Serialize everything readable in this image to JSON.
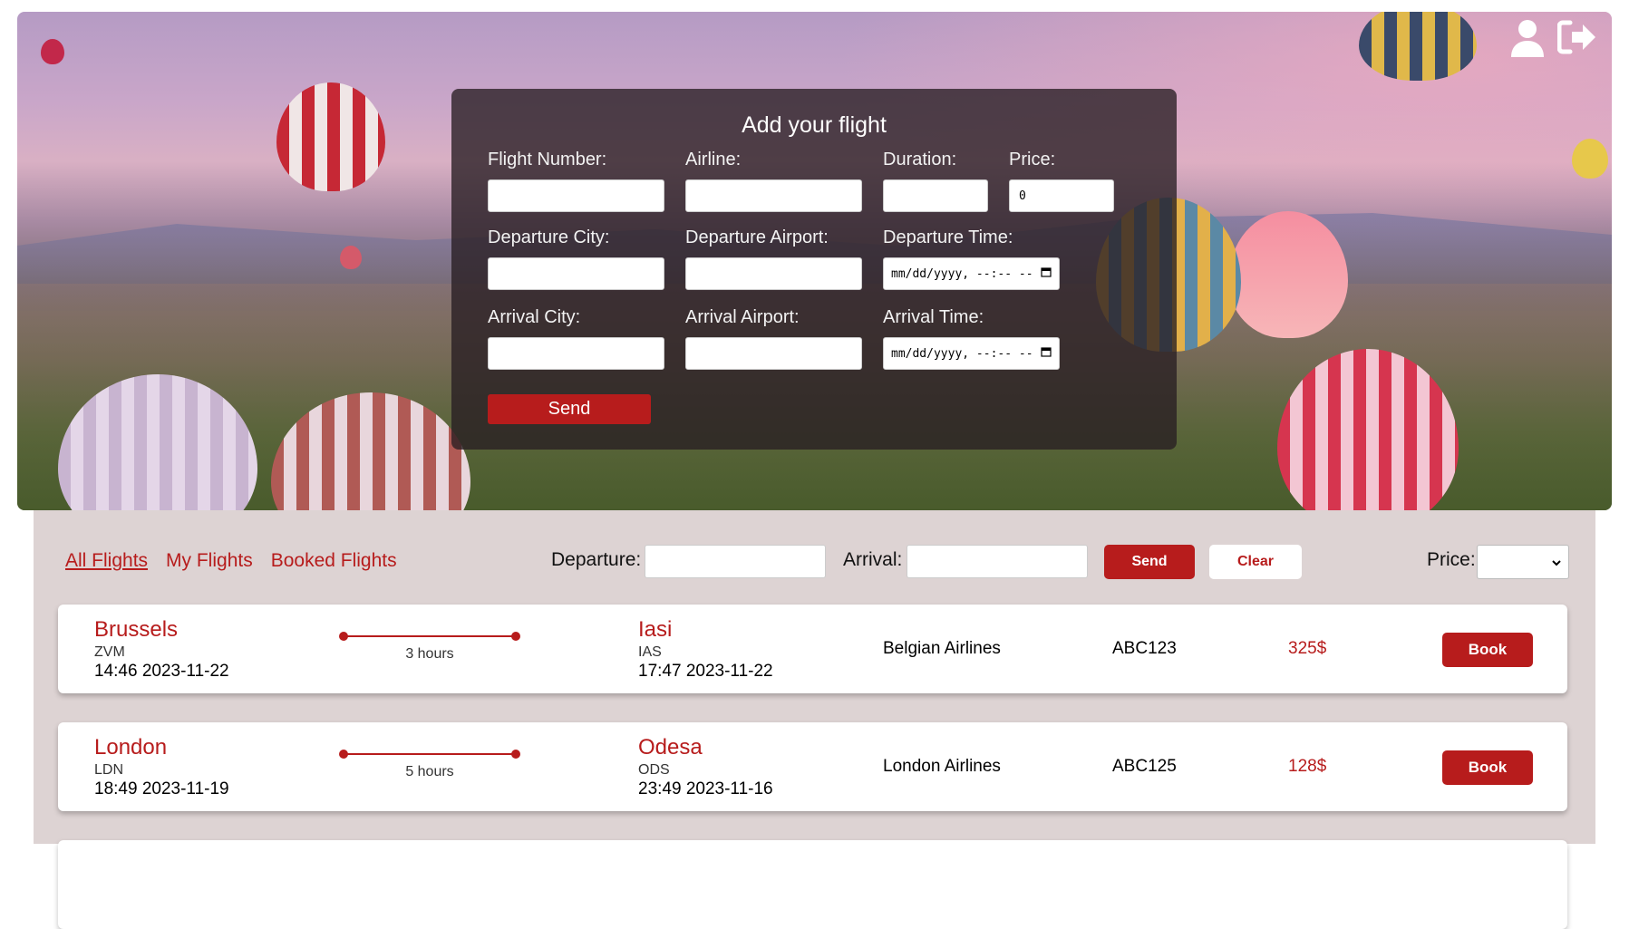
{
  "form": {
    "title": "Add your flight",
    "labels": {
      "flight_number": "Flight Number:",
      "airline": "Airline:",
      "duration": "Duration:",
      "price": "Price:",
      "departure_city": "Departure City:",
      "departure_airport": "Departure Airport:",
      "departure_time": "Departure Time:",
      "arrival_city": "Arrival City:",
      "arrival_airport": "Arrival Airport:",
      "arrival_time": "Arrival Time:"
    },
    "values": {
      "price": "0",
      "departure_time": "mm/dd/yyyy, --:-- --",
      "arrival_time": "mm/dd/yyyy, --:-- --"
    },
    "send_label": "Send"
  },
  "header": {
    "icons": [
      "user-icon",
      "sign-out-icon"
    ]
  },
  "filters": {
    "tabs": [
      {
        "label": "All Flights",
        "active": true
      },
      {
        "label": "My Flights",
        "active": false
      },
      {
        "label": "Booked Flights",
        "active": false
      }
    ],
    "departure_label": "Departure:",
    "arrival_label": "Arrival:",
    "send_label": "Send",
    "clear_label": "Clear",
    "price_label": "Price:"
  },
  "flights": [
    {
      "dep_city": "Brussels",
      "dep_code": "ZVM",
      "dep_time": "14:46 2023-11-22",
      "duration": "3 hours",
      "arr_city": "Iasi",
      "arr_code": "IAS",
      "arr_time": "17:47 2023-11-22",
      "airline": "Belgian Airlines",
      "number": "ABC123",
      "price": "325$",
      "book_label": "Book"
    },
    {
      "dep_city": "London",
      "dep_code": "LDN",
      "dep_time": "18:49 2023-11-19",
      "duration": "5 hours",
      "arr_city": "Odesa",
      "arr_code": "ODS",
      "arr_time": "23:49 2023-11-16",
      "airline": "London Airlines",
      "number": "ABC125",
      "price": "128$",
      "book_label": "Book"
    }
  ],
  "colors": {
    "accent": "#b71c1c",
    "section_bg": "#ddd3d3"
  }
}
